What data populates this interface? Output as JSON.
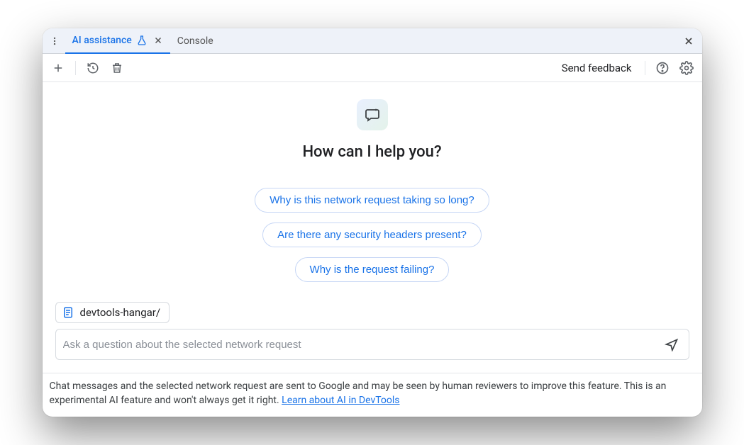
{
  "tabs": {
    "active_label": "AI assistance",
    "inactive_label": "Console"
  },
  "toolbar": {
    "send_feedback": "Send feedback"
  },
  "hero": {
    "title": "How can I help you?"
  },
  "suggestions": [
    "Why is this network request taking so long?",
    "Are there any security headers present?",
    "Why is the request failing?"
  ],
  "context": {
    "chip_label": "devtools-hangar/"
  },
  "input": {
    "placeholder": "Ask a question about the selected network request"
  },
  "disclaimer": {
    "text_before": "Chat messages and the selected network request are sent to Google and may be seen by human reviewers to improve this feature. This is an experimental AI feature and won't always get it right. ",
    "link_text": "Learn about AI in DevTools"
  }
}
